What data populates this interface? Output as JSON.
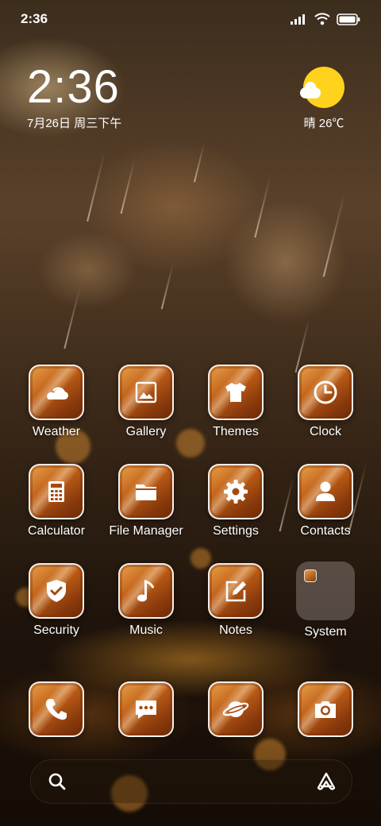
{
  "status_bar": {
    "time": "2:36"
  },
  "clock_widget": {
    "time": "2:36",
    "date": "7月26日 周三下午"
  },
  "weather_widget": {
    "text": "晴 26℃",
    "icon": "sunny-partly-cloudy-icon",
    "sun_color": "#ffd21e"
  },
  "apps_row1": [
    {
      "label": "Weather",
      "icon": "weather-icon"
    },
    {
      "label": "Gallery",
      "icon": "gallery-icon"
    },
    {
      "label": "Themes",
      "icon": "themes-icon"
    },
    {
      "label": "Clock",
      "icon": "clock-icon"
    }
  ],
  "apps_row2": [
    {
      "label": "Calculator",
      "icon": "calculator-icon"
    },
    {
      "label": "File Manager",
      "icon": "folder-icon"
    },
    {
      "label": "Settings",
      "icon": "gear-icon"
    },
    {
      "label": "Contacts",
      "icon": "contact-icon"
    }
  ],
  "apps_row3": [
    {
      "label": "Security",
      "icon": "shield-check-icon"
    },
    {
      "label": "Music",
      "icon": "music-note-icon"
    },
    {
      "label": "Notes",
      "icon": "notes-icon"
    },
    {
      "label": "System",
      "icon": "folder-group-icon"
    }
  ],
  "dock": [
    {
      "icon": "phone-icon"
    },
    {
      "icon": "messages-icon"
    },
    {
      "icon": "browser-planet-icon"
    },
    {
      "icon": "camera-icon"
    }
  ],
  "search_bar": {
    "left_icon": "search-icon",
    "right_icon": "assistant-icon"
  },
  "theme": {
    "icon_accent": "#c05f17",
    "icon_border": "#ffffff"
  }
}
